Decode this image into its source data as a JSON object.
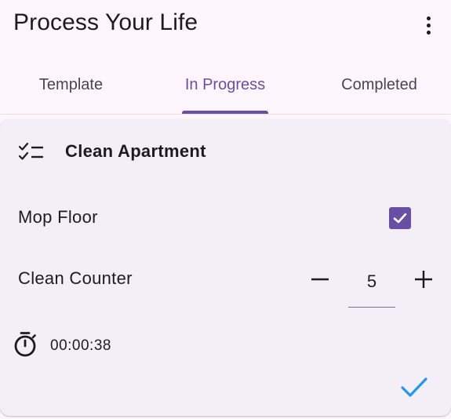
{
  "app_bar": {
    "title": "Process Your Life",
    "menu_icon": "more-vert-icon"
  },
  "tabs": [
    {
      "label": "Template",
      "selected": false
    },
    {
      "label": "In Progress",
      "selected": true
    },
    {
      "label": "Completed",
      "selected": false
    }
  ],
  "colors": {
    "primary": "#6750a4",
    "background": "#fdf7fd",
    "card": "#f4eff6",
    "accent_check": "#2196f3"
  },
  "card": {
    "header_icon": "checklist-icon",
    "title": "Clean Apartment",
    "items": [
      {
        "label": "Mop Floor",
        "type": "checkbox",
        "checked": true
      },
      {
        "label": "Clean Counter",
        "type": "counter",
        "value": "5"
      }
    ],
    "timer": {
      "icon": "timer-icon",
      "value": "00:00:38"
    },
    "done_icon": "check-icon"
  }
}
